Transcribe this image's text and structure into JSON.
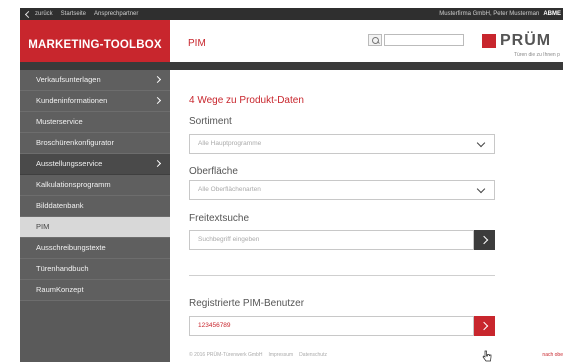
{
  "topbar": {
    "back": "zurück",
    "home": "Startseite",
    "contacts": "Ansprechpartner",
    "user": "Musterfirma GmbH, Peter Musterman",
    "logout": "ABME"
  },
  "header": {
    "brand": "MARKETING-TOOLBOX",
    "title": "PIM",
    "logo_word": "PRÜM",
    "logo_tagline": "Türen die zu Ihnen p"
  },
  "sidebar": {
    "items": [
      {
        "label": "Verkaufsunterlagen",
        "has_arrow": true
      },
      {
        "label": "Kundeninformationen",
        "has_arrow": true
      },
      {
        "label": "Musterservice",
        "has_arrow": false
      },
      {
        "label": "Broschürenkonfigurator",
        "has_arrow": false
      },
      {
        "label": "Ausstellungsservice",
        "has_arrow": true
      },
      {
        "label": "Kalkulationsprogramm",
        "has_arrow": false
      },
      {
        "label": "Bilddatenbank",
        "has_arrow": false
      },
      {
        "label": "PIM",
        "has_arrow": false,
        "active": true
      },
      {
        "label": "Ausschreibungstexte",
        "has_arrow": false
      },
      {
        "label": "Türenhandbuch",
        "has_arrow": false
      },
      {
        "label": "RaumKonzept",
        "has_arrow": false
      }
    ]
  },
  "main": {
    "title": "4 Wege zu Produkt-Daten",
    "sortiment": {
      "label": "Sortiment",
      "selected": "Alle Hauptprogramme"
    },
    "oberflaeche": {
      "label": "Oberfläche",
      "selected": "Alle Oberflächenarten"
    },
    "freitext": {
      "label": "Freitextsuche",
      "placeholder": "Suchbegriff eingeben"
    },
    "pim_users": {
      "label": "Registrierte PIM-Benutzer",
      "value": "123456789"
    }
  },
  "footer": {
    "copyright": "© 2016 PRÜM-Türenwerk GmbH",
    "impressum": "Impressum",
    "datenschutz": "Datenschutz",
    "back_to_top": "nach obe"
  },
  "colors": {
    "accent": "#c8262d",
    "sidebar": "#5a5a5a",
    "topbar": "#2f2f2f"
  }
}
